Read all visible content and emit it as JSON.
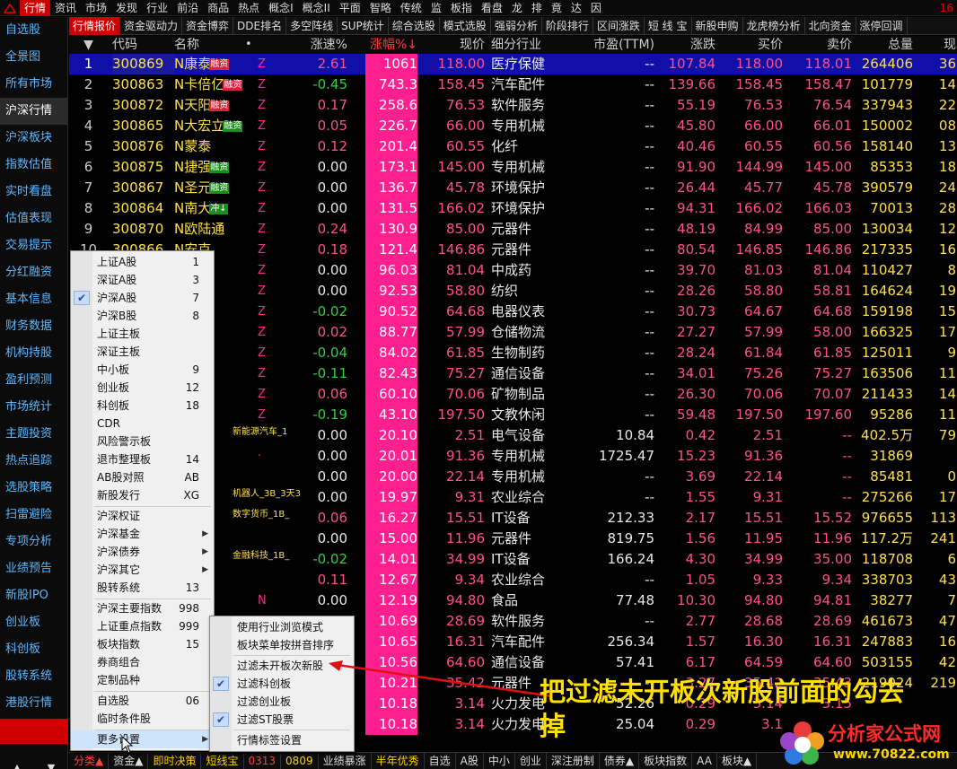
{
  "top_menu": {
    "items": [
      "行情",
      "资讯",
      "市场",
      "发现",
      "行业",
      "前沿",
      "商品",
      "热点",
      "概念I",
      "概念II",
      "平面",
      "智略",
      "传统",
      "监",
      "板指",
      "看盘",
      "龙",
      "排",
      "竟",
      "达",
      "因"
    ],
    "active_index": 0,
    "right_text": "16"
  },
  "left_nav": {
    "items": [
      "自选股",
      "全景图",
      "所有市场",
      "沪深行情",
      "沪深板块",
      "指数估值",
      "实时看盘",
      "估值表现",
      "交易提示",
      "分红融资",
      "基本信息",
      "财务数据",
      "机构持股",
      "盈利预测",
      "市场统计",
      "主题投资",
      "热点追踪",
      "选股策略",
      "扫雷避险",
      "专项分析",
      "业绩预告",
      "新股IPO",
      "创业板",
      "科创板",
      "股转系统",
      "港股行情"
    ],
    "active_index": 3,
    "arrow_up": "▲",
    "arrow_down": "▼"
  },
  "tabs": {
    "items": [
      "行情报价",
      "资金驱动力",
      "资金博弈",
      "DDE排名",
      "多空阵线",
      "SUP统计",
      "综合选股",
      "模式选股",
      "强弱分析",
      "阶段排行",
      "区间涨跌",
      "短 线 宝",
      "新股申购",
      "龙虎榜分析",
      "北向资金",
      "涨停回调"
    ],
    "active_index": 0
  },
  "table": {
    "headers": {
      "sel": "▼",
      "code": "代码",
      "name": "名称",
      "dot": "•",
      "zs": "涨速%",
      "zf": "涨幅%↓",
      "xj": "现价",
      "ind": "细分行业",
      "pe": "市盈(TTM)",
      "zd": "涨跌",
      "buy": "买价",
      "sell": "卖价",
      "vol": "总量",
      "cur": "现"
    },
    "rows": [
      {
        "n": "1",
        "code": "300869",
        "name": "N康泰",
        "tag": "融资",
        "tagc": "r",
        "flag": "Z",
        "zs": "2.61",
        "zf": "1061",
        "xj": "118.00",
        "ind": "医疗保健",
        "pe": "--",
        "zd": "107.84",
        "buy": "118.00",
        "sell": "118.01",
        "vol": "264406",
        "cur": "36"
      },
      {
        "n": "2",
        "code": "300863",
        "name": "N卡倍亿",
        "tag": "融资",
        "tagc": "r",
        "flag": "Z",
        "zs": "-0.45",
        "zf": "743.3",
        "xj": "158.45",
        "ind": "汽车配件",
        "pe": "--",
        "zd": "139.66",
        "buy": "158.45",
        "sell": "158.47",
        "vol": "101779",
        "cur": "14"
      },
      {
        "n": "3",
        "code": "300872",
        "name": "N天阳",
        "tag": "融资",
        "tagc": "r",
        "flag": "Z",
        "zs": "0.17",
        "zf": "258.6",
        "xj": "76.53",
        "ind": "软件服务",
        "pe": "--",
        "zd": "55.19",
        "buy": "76.53",
        "sell": "76.54",
        "vol": "337943",
        "cur": "22"
      },
      {
        "n": "4",
        "code": "300865",
        "name": "N大宏立",
        "tag": "融资",
        "tagc": "g",
        "flag": "Z",
        "zs": "0.05",
        "zf": "226.7",
        "xj": "66.00",
        "ind": "专用机械",
        "pe": "--",
        "zd": "45.80",
        "buy": "66.00",
        "sell": "66.01",
        "vol": "150002",
        "cur": "08"
      },
      {
        "n": "5",
        "code": "300876",
        "name": "N蒙泰",
        "tag": "",
        "tagc": "",
        "flag": "Z",
        "zs": "0.12",
        "zf": "201.4",
        "xj": "60.55",
        "ind": "化纤",
        "pe": "--",
        "zd": "40.46",
        "buy": "60.55",
        "sell": "60.56",
        "vol": "158140",
        "cur": "13"
      },
      {
        "n": "6",
        "code": "300875",
        "name": "N捷强",
        "tag": "融资",
        "tagc": "g",
        "flag": "Z",
        "zs": "0.00",
        "zf": "173.1",
        "xj": "145.00",
        "ind": "专用机械",
        "pe": "--",
        "zd": "91.90",
        "buy": "144.99",
        "sell": "145.00",
        "vol": "85353",
        "cur": "18"
      },
      {
        "n": "7",
        "code": "300867",
        "name": "N圣元",
        "tag": "融资",
        "tagc": "g",
        "flag": "Z",
        "zs": "0.00",
        "zf": "136.7",
        "xj": "45.78",
        "ind": "环境保护",
        "pe": "--",
        "zd": "26.44",
        "buy": "45.77",
        "sell": "45.78",
        "vol": "390579",
        "cur": "24"
      },
      {
        "n": "8",
        "code": "300864",
        "name": "N南大",
        "tag": "冲↓",
        "tagc": "g",
        "flag": "Z",
        "zs": "0.00",
        "zf": "131.5",
        "xj": "166.02",
        "ind": "环境保护",
        "pe": "--",
        "zd": "94.31",
        "buy": "166.02",
        "sell": "166.03",
        "vol": "70013",
        "cur": "28"
      },
      {
        "n": "9",
        "code": "300870",
        "name": "N欧陆通",
        "tag": "",
        "tagc": "",
        "flag": "Z",
        "zs": "0.24",
        "zf": "130.9",
        "xj": "85.00",
        "ind": "元器件",
        "pe": "--",
        "zd": "48.19",
        "buy": "84.99",
        "sell": "85.00",
        "vol": "130034",
        "cur": "12"
      },
      {
        "n": "10",
        "code": "300866",
        "name": "N安克",
        "tag": "",
        "tagc": "",
        "flag": "Z",
        "zs": "0.18",
        "zf": "121.4",
        "xj": "146.86",
        "ind": "元器件",
        "pe": "--",
        "zd": "80.54",
        "buy": "146.85",
        "sell": "146.86",
        "vol": "217335",
        "cur": "16"
      },
      {
        "n": "",
        "code": "",
        "name": "",
        "tag": "",
        "tagc": "",
        "flag": "Z",
        "zs": "0.00",
        "zf": "96.03",
        "xj": "81.04",
        "ind": "中成药",
        "pe": "--",
        "zd": "39.70",
        "buy": "81.03",
        "sell": "81.04",
        "vol": "110427",
        "cur": "8"
      },
      {
        "n": "",
        "code": "",
        "name": "",
        "tag": "融资",
        "tagc": "r",
        "flag": "Z",
        "zs": "0.00",
        "zf": "92.53",
        "xj": "58.80",
        "ind": "纺织",
        "pe": "--",
        "zd": "28.26",
        "buy": "58.80",
        "sell": "58.81",
        "vol": "164624",
        "cur": "19"
      },
      {
        "n": "",
        "code": "",
        "name": "",
        "tag": "",
        "tagc": "",
        "flag": "Z",
        "zs": "-0.02",
        "zf": "90.52",
        "xj": "64.68",
        "ind": "电器仪表",
        "pe": "--",
        "zd": "30.73",
        "buy": "64.67",
        "sell": "64.68",
        "vol": "159198",
        "cur": "15"
      },
      {
        "n": "",
        "code": "",
        "name": "",
        "tag": "",
        "tagc": "",
        "flag": "Z",
        "zs": "0.02",
        "zf": "88.77",
        "xj": "57.99",
        "ind": "仓储物流",
        "pe": "--",
        "zd": "27.27",
        "buy": "57.99",
        "sell": "58.00",
        "vol": "166325",
        "cur": "17"
      },
      {
        "n": "",
        "code": "",
        "name": "",
        "tag": "",
        "tagc": "",
        "flag": "Z",
        "zs": "-0.04",
        "zf": "84.02",
        "xj": "61.85",
        "ind": "生物制药",
        "pe": "--",
        "zd": "28.24",
        "buy": "61.84",
        "sell": "61.85",
        "vol": "125011",
        "cur": "9"
      },
      {
        "n": "",
        "code": "",
        "name": "特",
        "tag": "",
        "tagc": "",
        "flag": "Z",
        "zs": "-0.11",
        "zf": "82.43",
        "xj": "75.27",
        "ind": "通信设备",
        "pe": "--",
        "zd": "34.01",
        "buy": "75.26",
        "sell": "75.27",
        "vol": "163506",
        "cur": "11"
      },
      {
        "n": "",
        "code": "",
        "name": "",
        "tag": "",
        "tagc": "",
        "flag": "Z",
        "zs": "0.06",
        "zf": "60.10",
        "xj": "70.06",
        "ind": "矿物制品",
        "pe": "--",
        "zd": "26.30",
        "buy": "70.06",
        "sell": "70.07",
        "vol": "211433",
        "cur": "14"
      },
      {
        "n": "",
        "code": "",
        "name": "",
        "tag": "融资",
        "tagc": "r",
        "flag": "Z",
        "zs": "-0.19",
        "zf": "43.10",
        "xj": "197.50",
        "ind": "文教休闲",
        "pe": "--",
        "zd": "59.48",
        "buy": "197.50",
        "sell": "197.60",
        "vol": "95286",
        "cur": "11"
      },
      {
        "n": "",
        "code": "",
        "name": "能高",
        "tag": "",
        "tagc": "",
        "flag": "",
        "zs": "0.00",
        "zf": "20.10",
        "xj": "2.51",
        "ind": "电气设备",
        "pe": "10.84",
        "zd": "0.42",
        "buy": "2.51",
        "sell": "--",
        "vol": "402.5万",
        "cur": "79"
      },
      {
        "n": "",
        "code": "",
        "name": "份立",
        "tag": "",
        "tagc": "",
        "flag": "·",
        "zs": "0.00",
        "zf": "20.01",
        "xj": "91.36",
        "ind": "专用机械",
        "pe": "1725.47",
        "zd": "15.23",
        "buy": "91.36",
        "sell": "--",
        "vol": "31869",
        "cur": ""
      },
      {
        "n": "",
        "code": "",
        "name": "机高",
        "tag": "",
        "tagc": "",
        "flag": "",
        "zs": "0.00",
        "zf": "20.00",
        "xj": "22.14",
        "ind": "专用机械",
        "pe": "--",
        "zd": "3.69",
        "buy": "22.14",
        "sell": "--",
        "vol": "85481",
        "cur": "0"
      },
      {
        "n": "",
        "code": "",
        "name": "物高",
        "tag": "",
        "tagc": "",
        "flag": "",
        "zs": "0.00",
        "zf": "19.97",
        "xj": "9.31",
        "ind": "农业综合",
        "pe": "--",
        "zd": "1.55",
        "buy": "9.31",
        "sell": "--",
        "vol": "275266",
        "cur": "17"
      },
      {
        "n": "",
        "code": "",
        "name": "份高",
        "tag": "",
        "tagc": "",
        "flag": "",
        "zs": "0.06",
        "zf": "16.27",
        "xj": "15.51",
        "ind": "IT设备",
        "pe": "212.33",
        "zd": "2.17",
        "buy": "15.51",
        "sell": "15.52",
        "vol": "976655",
        "cur": "113"
      },
      {
        "n": "",
        "code": "",
        "name": "",
        "tag": "融资",
        "tagc": "g",
        "flag": "",
        "zs": "0.00",
        "zf": "15.00",
        "xj": "11.96",
        "ind": "元器件",
        "pe": "819.75",
        "zd": "1.56",
        "buy": "11.95",
        "sell": "11.96",
        "vol": "117.2万",
        "cur": "241"
      },
      {
        "n": "",
        "code": "",
        "name": "技",
        "tag": "",
        "tagc": "",
        "flag": "",
        "zs": "-0.02",
        "zf": "14.01",
        "xj": "34.99",
        "ind": "IT设备",
        "pe": "166.24",
        "zd": "4.30",
        "buy": "34.99",
        "sell": "35.00",
        "vol": "118708",
        "cur": "6"
      },
      {
        "n": "",
        "code": "",
        "name": "业高",
        "tag": "",
        "tagc": "",
        "flag": "",
        "zs": "0.11",
        "zf": "12.67",
        "xj": "9.34",
        "ind": "农业综合",
        "pe": "--",
        "zd": "1.05",
        "buy": "9.33",
        "sell": "9.34",
        "vol": "338703",
        "cur": "43"
      },
      {
        "n": "",
        "code": "",
        "name": "技拉",
        "tag": "",
        "tagc": "",
        "flag": "N",
        "zs": "0.00",
        "zf": "12.19",
        "xj": "94.80",
        "ind": "食品",
        "pe": "77.48",
        "zd": "10.30",
        "buy": "94.80",
        "sell": "94.81",
        "vol": "38277",
        "cur": "7"
      },
      {
        "n": "",
        "code": "",
        "name": "",
        "tag": "",
        "tagc": "",
        "flag": "",
        "zs": "",
        "zf": "10.69",
        "xj": "28.69",
        "ind": "软件服务",
        "pe": "--",
        "zd": "2.77",
        "buy": "28.68",
        "sell": "28.69",
        "vol": "461673",
        "cur": "47"
      },
      {
        "n": "",
        "code": "",
        "name": "",
        "tag": "",
        "tagc": "",
        "flag": "",
        "zs": "",
        "zf": "10.65",
        "xj": "16.31",
        "ind": "汽车配件",
        "pe": "256.34",
        "zd": "1.57",
        "buy": "16.30",
        "sell": "16.31",
        "vol": "247883",
        "cur": "16"
      },
      {
        "n": "",
        "code": "",
        "name": "",
        "tag": "",
        "tagc": "",
        "flag": "",
        "zs": "",
        "zf": "10.56",
        "xj": "64.60",
        "ind": "通信设备",
        "pe": "57.41",
        "zd": "6.17",
        "buy": "64.59",
        "sell": "64.60",
        "vol": "503155",
        "cur": "42"
      },
      {
        "n": "",
        "code": "",
        "name": "",
        "tag": "",
        "tagc": "",
        "flag": "",
        "zs": "",
        "zf": "10.21",
        "xj": "35.42",
        "ind": "元器件",
        "pe": "--",
        "zd": "3.27",
        "buy": "35.42",
        "sell": "35.43",
        "vol": "219024",
        "cur": "219"
      },
      {
        "n": "",
        "code": "",
        "name": "",
        "tag": "",
        "tagc": "",
        "flag": "",
        "zs": "",
        "zf": "10.18",
        "xj": "3.14",
        "ind": "火力发电",
        "pe": "52.26",
        "zd": "0.29",
        "buy": "3.14",
        "sell": "3.15",
        "vol": "",
        "cur": ""
      },
      {
        "n": "",
        "code": "",
        "name": "",
        "tag": "",
        "tagc": "",
        "flag": "",
        "zs": "",
        "zf": "10.18",
        "xj": "3.14",
        "ind": "火力发电",
        "pe": "25.04",
        "zd": "0.29",
        "buy": "3.1",
        "sell": "",
        "vol": "",
        "cur": ""
      }
    ],
    "inline_labels": [
      {
        "text": "新能源汽车_1",
        "row": 18
      },
      {
        "text": "数字货币_1B_",
        "row": 22
      },
      {
        "text": "金融科技_1B_",
        "row": 24
      },
      {
        "text": "机器人_3B_3天3",
        "row": 21
      }
    ]
  },
  "bottom_tabs": {
    "items": [
      {
        "label": "分类▲",
        "cls": "hl"
      },
      {
        "label": "资金▲",
        "cls": ""
      },
      {
        "label": "即时决策",
        "cls": "yl"
      },
      {
        "label": "短线宝",
        "cls": "yl"
      },
      {
        "label": "0313",
        "cls": "hl"
      },
      {
        "label": "0809",
        "cls": "yl"
      },
      {
        "label": "业绩暴涨",
        "cls": ""
      },
      {
        "label": "半年优秀",
        "cls": "yl"
      },
      {
        "label": "自选",
        "cls": ""
      },
      {
        "label": "A股",
        "cls": ""
      },
      {
        "label": "中小",
        "cls": ""
      },
      {
        "label": "创业",
        "cls": ""
      },
      {
        "label": "深注册制",
        "cls": ""
      },
      {
        "label": "债券▲",
        "cls": ""
      },
      {
        "label": "板块指数",
        "cls": ""
      },
      {
        "label": "AA",
        "cls": ""
      },
      {
        "label": "板块▲",
        "cls": ""
      }
    ]
  },
  "context_menu_main": {
    "items": [
      {
        "label": "上证A股",
        "shortcut": "1",
        "checked": false,
        "arrow": false
      },
      {
        "label": "深证A股",
        "shortcut": "3",
        "checked": false,
        "arrow": false
      },
      {
        "label": "沪深A股",
        "shortcut": "7",
        "checked": true,
        "arrow": false
      },
      {
        "label": "沪深B股",
        "shortcut": "8",
        "checked": false,
        "arrow": false
      },
      {
        "label": "上证主板",
        "shortcut": "",
        "checked": false,
        "arrow": false
      },
      {
        "label": "深证主板",
        "shortcut": "",
        "checked": false,
        "arrow": false
      },
      {
        "label": "中小板",
        "shortcut": "9",
        "checked": false,
        "arrow": false
      },
      {
        "label": "创业板",
        "shortcut": "12",
        "checked": false,
        "arrow": false
      },
      {
        "label": "科创板",
        "shortcut": "18",
        "checked": false,
        "arrow": false
      },
      {
        "label": "CDR",
        "shortcut": "",
        "checked": false,
        "arrow": false
      },
      {
        "label": "风险警示板",
        "shortcut": "",
        "checked": false,
        "arrow": false
      },
      {
        "label": "退市整理板",
        "shortcut": "14",
        "checked": false,
        "arrow": false
      },
      {
        "label": "AB股对照",
        "shortcut": "AB",
        "checked": false,
        "arrow": false
      },
      {
        "label": "新股发行",
        "shortcut": "XG",
        "checked": false,
        "arrow": false
      },
      {
        "sep": true
      },
      {
        "label": "沪深权证",
        "shortcut": "",
        "checked": false,
        "arrow": false
      },
      {
        "label": "沪深基金",
        "shortcut": "",
        "checked": false,
        "arrow": true
      },
      {
        "label": "沪深债券",
        "shortcut": "",
        "checked": false,
        "arrow": true
      },
      {
        "label": "沪深其它",
        "shortcut": "",
        "checked": false,
        "arrow": true
      },
      {
        "label": "股转系统",
        "shortcut": "13",
        "checked": false,
        "arrow": false
      },
      {
        "sep": true
      },
      {
        "label": "沪深主要指数",
        "shortcut": "998",
        "checked": false,
        "arrow": false
      },
      {
        "label": "上证重点指数",
        "shortcut": "999",
        "checked": false,
        "arrow": false
      },
      {
        "label": "板块指数",
        "shortcut": "15",
        "checked": false,
        "arrow": false
      },
      {
        "label": "券商组合",
        "shortcut": "",
        "checked": false,
        "arrow": false
      },
      {
        "label": "定制品种",
        "shortcut": "",
        "checked": false,
        "arrow": false
      },
      {
        "sep": true
      },
      {
        "label": "自选股",
        "shortcut": "06",
        "checked": false,
        "arrow": false
      },
      {
        "label": "临时条件股",
        "shortcut": "",
        "checked": false,
        "arrow": false
      },
      {
        "sep": true
      },
      {
        "label": "更多设置",
        "shortcut": "",
        "checked": false,
        "arrow": true,
        "hover": true
      }
    ]
  },
  "context_menu_sub": {
    "items": [
      {
        "label": "使用行业浏览模式",
        "checked": false
      },
      {
        "label": "板块菜单按拼音排序",
        "checked": false
      },
      {
        "sep": true
      },
      {
        "label": "过滤未开板次新股",
        "checked": false
      },
      {
        "label": "过滤科创板",
        "checked": true
      },
      {
        "label": "过滤创业板",
        "checked": false
      },
      {
        "label": "过滤ST股票",
        "checked": true
      },
      {
        "sep": true
      },
      {
        "label": "行情标签设置",
        "checked": false
      }
    ]
  },
  "annotation": {
    "text": "把过滤未开板次新股前面的勾去掉",
    "color": "#ffe000",
    "arrow_color": "#e01010"
  },
  "watermark": {
    "title": "分析家公式网",
    "url": "www.70822.com"
  },
  "colors": {
    "red_up": "#ff4f8e",
    "green_down": "#30d040",
    "zf_bg": "#ff1f8f",
    "code_yellow": "#ffe04a",
    "nav_blue": "#5cb8ff",
    "active_red": "#cc0000",
    "selected_row": "#1010a8"
  }
}
